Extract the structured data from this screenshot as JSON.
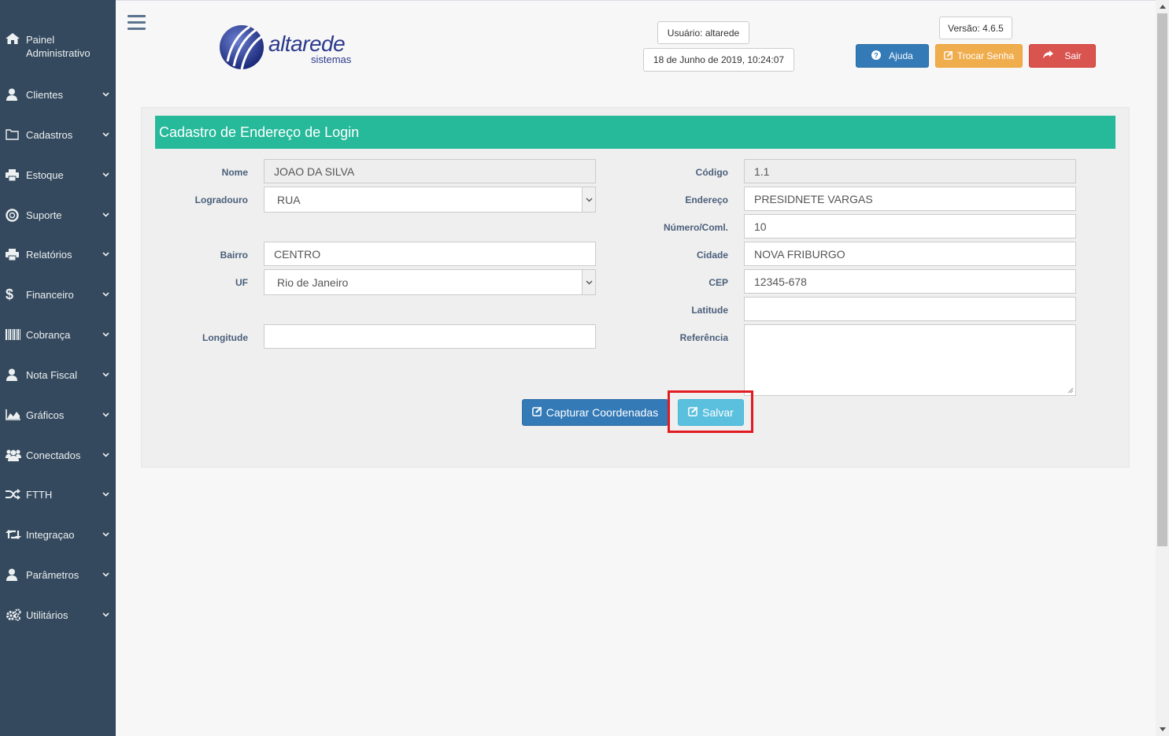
{
  "sidebar": {
    "brand": "Painel Administrativo",
    "items": [
      {
        "label": "Clientes",
        "icon": "user-icon"
      },
      {
        "label": "Cadastros",
        "icon": "folder-icon"
      },
      {
        "label": "Estoque",
        "icon": "print-icon"
      },
      {
        "label": "Suporte",
        "icon": "lifebuoy-icon"
      },
      {
        "label": "Relatórios",
        "icon": "print-icon"
      },
      {
        "label": "Financeiro",
        "icon": "dollar-icon"
      },
      {
        "label": "Cobrança",
        "icon": "barcode-icon"
      },
      {
        "label": "Nota Fiscal",
        "icon": "user-icon"
      },
      {
        "label": "Gráficos",
        "icon": "area-chart-icon"
      },
      {
        "label": "Conectados",
        "icon": "users-icon"
      },
      {
        "label": "FTTH",
        "icon": "random-icon"
      },
      {
        "label": "Integraçao",
        "icon": "retweet-icon"
      },
      {
        "label": "Parâmetros",
        "icon": "user-icon"
      },
      {
        "label": "Utilitários",
        "icon": "cogs-icon"
      }
    ]
  },
  "header": {
    "logo_word": "altarede",
    "logo_sub": "sistemas",
    "user": "Usuário: altarede",
    "datetime": "18 de Junho de 2019, 10:24:07",
    "version": "Versão: 4.6.5",
    "help_label": "Ajuda",
    "change_password_label": "Trocar Senha",
    "exit_label": "Sair"
  },
  "form": {
    "title": "Cadastro de Endereço de Login",
    "nome_label": "Nome",
    "nome_value": "JOAO DA SILVA",
    "logradouro_label": "Logradouro",
    "logradouro_value": "RUA",
    "bairro_label": "Bairro",
    "bairro_value": "CENTRO",
    "uf_label": "UF",
    "uf_value": "Rio de Janeiro",
    "longitude_label": "Longitude",
    "longitude_value": "",
    "codigo_label": "Código",
    "codigo_value": "1.1",
    "endereco_label": "Endereço",
    "endereco_value": "PRESIDNETE VARGAS",
    "numero_label": "Número/Coml.",
    "numero_value": "10",
    "cidade_label": "Cidade",
    "cidade_value": "NOVA FRIBURGO",
    "cep_label": "CEP",
    "cep_value": "12345-678",
    "latitude_label": "Latitude",
    "latitude_value": "",
    "referencia_label": "Referência",
    "referencia_value": "",
    "capture_label": "Capturar Coordenadas",
    "save_label": "Salvar"
  },
  "colors": {
    "sidebar_bg": "#34495e",
    "panel_header": "#26b99a",
    "primary": "#337ab7",
    "warning": "#f0ad4e",
    "danger": "#d9534f",
    "info": "#5bc0de",
    "highlight": "#e21b23"
  }
}
